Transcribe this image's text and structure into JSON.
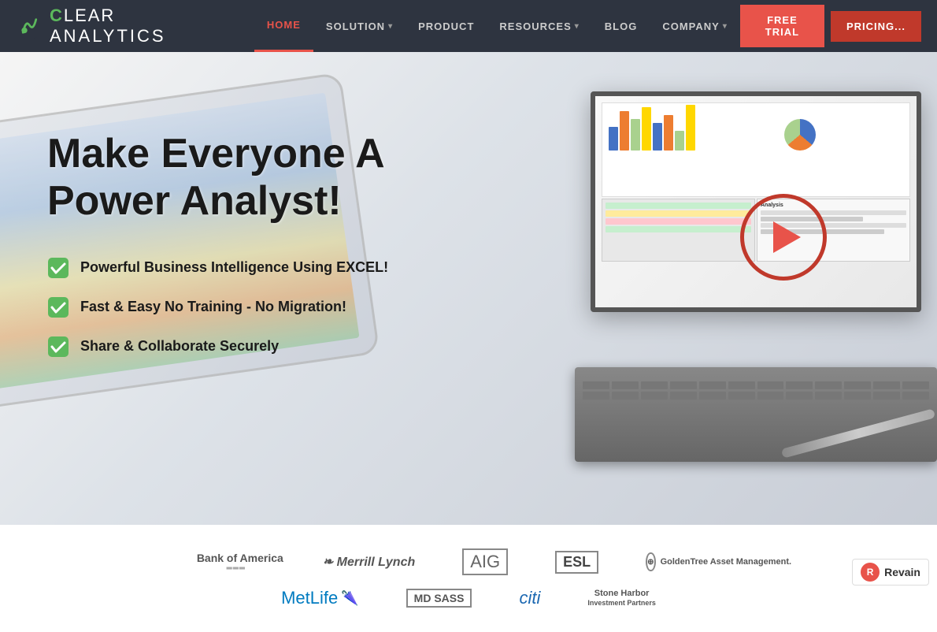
{
  "nav": {
    "logo_text_light": "LEAR",
    "logo_text_bold": "C",
    "logo_brand": "ANALYTICS",
    "links": [
      {
        "label": "HOME",
        "active": true,
        "has_dropdown": false
      },
      {
        "label": "SOLUTION",
        "active": false,
        "has_dropdown": true
      },
      {
        "label": "PRODUCT",
        "active": false,
        "has_dropdown": false
      },
      {
        "label": "RESOURCES",
        "active": false,
        "has_dropdown": true
      },
      {
        "label": "BLOG",
        "active": false,
        "has_dropdown": false
      },
      {
        "label": "COMPANY",
        "active": false,
        "has_dropdown": true
      }
    ],
    "free_trial_label": "FREE TRIAL",
    "pricing_label": "PRICING..."
  },
  "hero": {
    "title": "Make Everyone A Power Analyst!",
    "features": [
      {
        "text": "Powerful Business Intelligence Using EXCEL!"
      },
      {
        "text": "Fast & Easy No Training - No Migration!"
      },
      {
        "text": "Share & Collaborate Securely"
      }
    ]
  },
  "logos": {
    "row1": [
      {
        "name": "Bank of America",
        "style": "bank-of-america"
      },
      {
        "name": "Merrill Lynch",
        "style": "merrill"
      },
      {
        "name": "AIG",
        "style": "aig"
      },
      {
        "name": "ESL",
        "style": "esl"
      },
      {
        "name": "GoldenTree Asset Management.",
        "style": "goldentree"
      }
    ],
    "row2": [
      {
        "name": "MetLife",
        "style": "metlife"
      },
      {
        "name": "MD SASS",
        "style": "mdsass"
      },
      {
        "name": "citi",
        "style": "citi"
      },
      {
        "name": "Stone Harbor Investment Partners",
        "style": "stoneharbor"
      }
    ]
  },
  "revain": {
    "label": "Revain"
  }
}
